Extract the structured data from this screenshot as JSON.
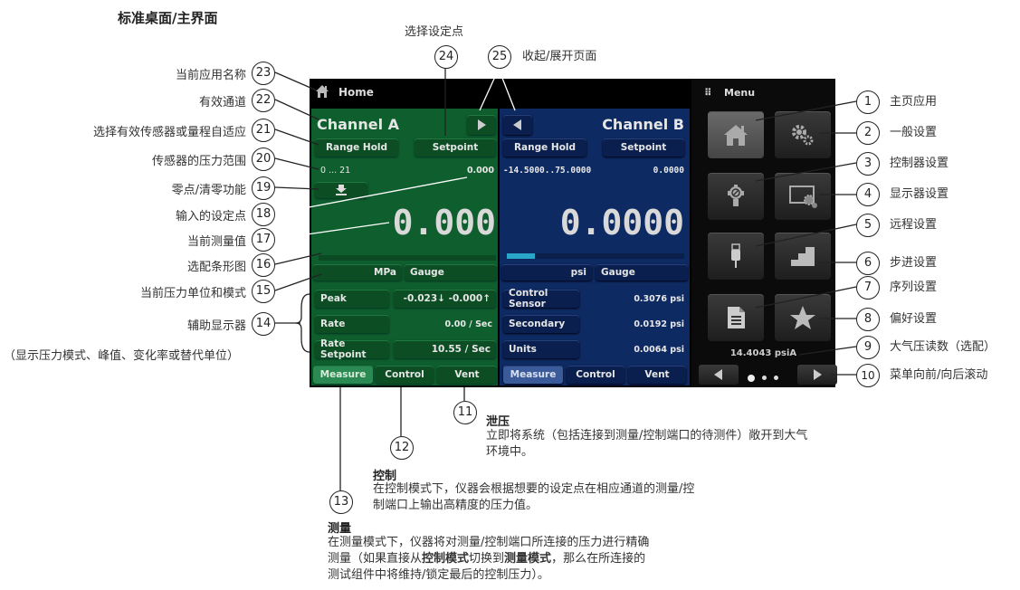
{
  "page_title": "标准桌面/主界面",
  "screen": {
    "app_name": "Home",
    "menu_label": "Menu",
    "channel_a": {
      "title": "Channel A",
      "range_hold": "Range Hold",
      "setpoint_button": "Setpoint",
      "range": "0 ... 21",
      "setpoint_value": "0.000",
      "reading": "0.000",
      "bar_fraction": 0,
      "unit": "MPa",
      "mode": "Gauge",
      "aux": [
        {
          "label": "Peak",
          "value": "-0.023↓  -0.000↑"
        },
        {
          "label": "Rate",
          "value": "0.00 / Sec"
        },
        {
          "label": "Rate Setpoint",
          "value": "10.55 / Sec"
        }
      ],
      "tabs": [
        "Measure",
        "Control",
        "Vent"
      ],
      "active_tab": "Measure",
      "color": "#0f5e2d"
    },
    "channel_b": {
      "title": "Channel B",
      "range_hold": "Range Hold",
      "setpoint_button": "Setpoint",
      "range": "-14.5000..75.0000",
      "setpoint_value": "0.0000",
      "reading": "0.0000",
      "bar_fraction": 0.16,
      "unit": "psi",
      "mode": "Gauge",
      "aux": [
        {
          "label": "Control Sensor",
          "value": "0.3076 psi"
        },
        {
          "label": "Secondary",
          "value": "0.0192 psi"
        },
        {
          "label": "Units",
          "value": "0.0064 psi"
        }
      ],
      "tabs": [
        "Measure",
        "Control",
        "Vent"
      ],
      "active_tab": "Measure",
      "color": "#0e2a63"
    },
    "menu_tiles": [
      {
        "icon": "home-icon",
        "active": true
      },
      {
        "icon": "gears-icon"
      },
      {
        "icon": "controller-icon"
      },
      {
        "icon": "display-settings-icon"
      },
      {
        "icon": "usb-plug-icon"
      },
      {
        "icon": "steps-icon"
      },
      {
        "icon": "document-icon"
      },
      {
        "icon": "star-icon"
      }
    ],
    "barometer": "14.4043 psiA",
    "page_indicator": {
      "pages": 3,
      "current": 1
    }
  },
  "callouts_left": [
    {
      "n": "23",
      "text": "当前应用名称"
    },
    {
      "n": "22",
      "text": "有效通道"
    },
    {
      "n": "21",
      "text": "选择有效传感器或量程自适应"
    },
    {
      "n": "20",
      "text": "传感器的压力范围"
    },
    {
      "n": "19",
      "text": "零点/清零功能"
    },
    {
      "n": "18",
      "text": "输入的设定点"
    },
    {
      "n": "17",
      "text": "当前测量值"
    },
    {
      "n": "16",
      "text": "选配条形图"
    },
    {
      "n": "15",
      "text": "当前压力单位和模式"
    },
    {
      "n": "14",
      "text": "辅助显示器"
    }
  ],
  "callout_14_sub": "（显示压力模式、峰值、变化率或替代单位）",
  "callouts_right": [
    {
      "n": "1",
      "text": "主页应用"
    },
    {
      "n": "2",
      "text": "一般设置"
    },
    {
      "n": "3",
      "text": "控制器设置"
    },
    {
      "n": "4",
      "text": "显示器设置"
    },
    {
      "n": "5",
      "text": "远程设置"
    },
    {
      "n": "6",
      "text": "步进设置"
    },
    {
      "n": "7",
      "text": "序列设置"
    },
    {
      "n": "8",
      "text": "偏好设置"
    },
    {
      "n": "9",
      "text": "大气压读数（选配）"
    },
    {
      "n": "10",
      "text": "菜单向前/向后滚动"
    }
  ],
  "callouts_top": [
    {
      "n": "24",
      "text": "选择设定点"
    },
    {
      "n": "25",
      "text": "收起/展开页面"
    }
  ],
  "callouts_bottom": [
    {
      "n": "11",
      "title": "泄压",
      "lines": [
        "立即将系统（包括连接到测量/控制端口的待测件）敞开到大气",
        "环境中。"
      ]
    },
    {
      "n": "12",
      "title": "控制",
      "lines": [
        "在控制模式下，仪器会根据想要的设定点在相应通道的测量/控",
        "制端口上输出高精度的压力值。"
      ]
    },
    {
      "n": "13",
      "title": "测量",
      "lines": [
        "在测量模式下，仪器将对测量/控制端口所连接的压力进行精确",
        "测量（如果直接从",
        "控制模式",
        "切换到",
        "测量模式",
        "，那么在所连接的",
        "测试组件中将维持/锁定最后的控制压力）。"
      ]
    }
  ]
}
